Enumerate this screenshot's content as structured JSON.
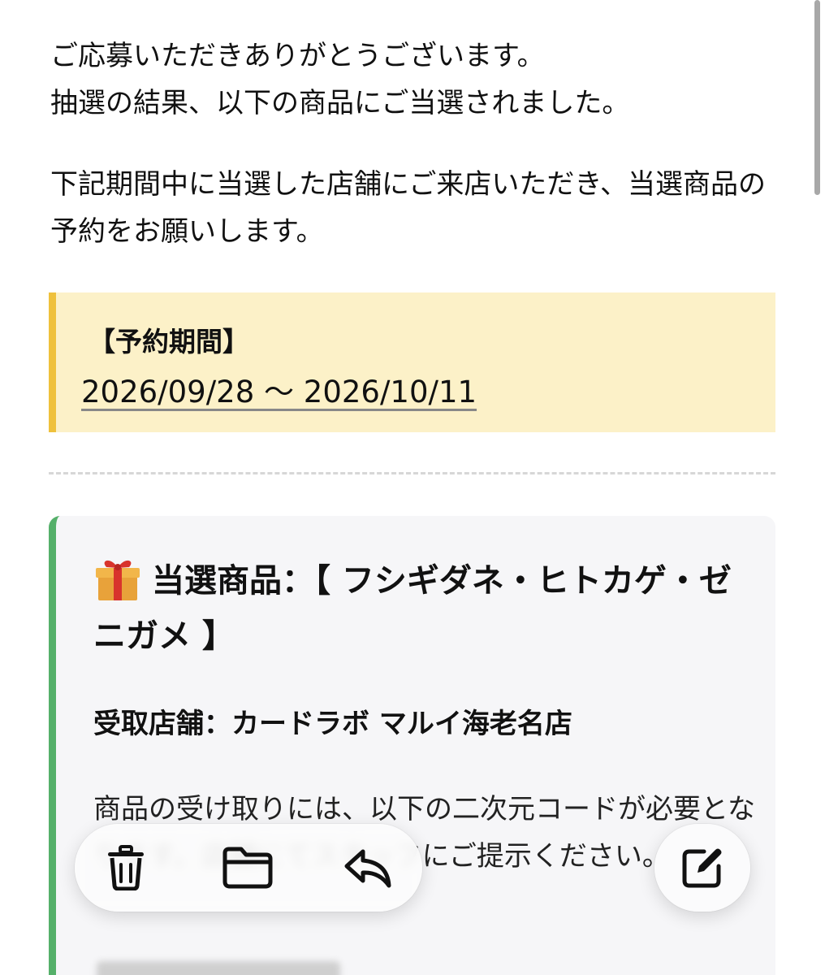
{
  "message": {
    "para1_line1": "ご応募いただきありがとうございます。",
    "para1_line2": "抽選の結果、以下の商品にご当選されました。",
    "para2": "下記期間中に当選した店舗にご来店いただき、当選商品の予約をお願いします。"
  },
  "reservation": {
    "label": "【予約期間】",
    "dates": "2026/09/28 〜 2026/10/11"
  },
  "prize_card": {
    "title": "当選商品：【 フシギダネ・ヒトカゲ・ゼニガメ 】",
    "icon": "gift-icon",
    "store": "受取店舗：カードラボ マルイ海老名店",
    "note": "商品の受け取りには、以下の二次元コードが必要となります。店舗にてスタッフにご提示ください。"
  },
  "toolbar": {
    "icons": [
      "trash-icon",
      "folder-icon",
      "reply-icon",
      "compose-icon"
    ]
  },
  "colors": {
    "highlight_bg": "#fcf1c8",
    "highlight_border": "#efc13c",
    "card_border": "#55b06a"
  }
}
